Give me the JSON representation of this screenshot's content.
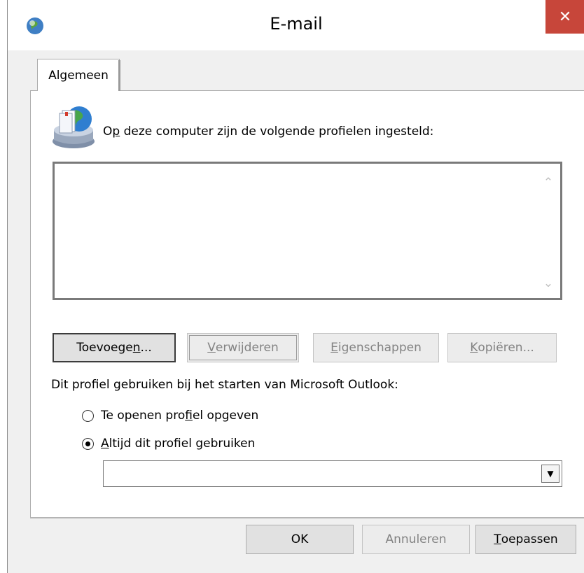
{
  "window": {
    "title": "E-mail",
    "close_glyph": "✕",
    "title_icon": "mail-globe-icon"
  },
  "tabs": [
    {
      "label": "Algemeen",
      "active": true
    }
  ],
  "profiles": {
    "icon": "mail-profiles-icon",
    "label_prefix": "O",
    "label_underlined": "p",
    "label_rest": " deze computer zijn de volgende profielen ingesteld:",
    "items": [],
    "scroll_up_glyph": "⌃",
    "scroll_down_glyph": "⌄"
  },
  "buttons": {
    "add": {
      "pre": "Toevoege",
      "u": "n",
      "post": "...",
      "enabled": true
    },
    "remove": {
      "pre": "",
      "u": "V",
      "post": "erwijderen",
      "enabled": false
    },
    "properties": {
      "pre": "",
      "u": "E",
      "post": "igenschappen",
      "enabled": false
    },
    "copy": {
      "pre": "",
      "u": "K",
      "post": "opiëren...",
      "enabled": false
    }
  },
  "startup": {
    "label": "Dit profiel gebruiken bij het starten van Microsoft Outlook:",
    "options": [
      {
        "pre": "Te openen pro",
        "u": "f",
        "post": "iel opgeven",
        "selected": false
      },
      {
        "pre": "",
        "u": "A",
        "post": "ltijd dit profiel gebruiken",
        "selected": true
      }
    ],
    "selected_profile": "",
    "dropdown_glyph": "▼"
  },
  "footer": {
    "ok": {
      "label": "OK",
      "enabled": true
    },
    "cancel": {
      "label": "Annuleren",
      "enabled": false
    },
    "apply": {
      "u": "T",
      "post": "oepassen",
      "enabled": true
    }
  },
  "colors": {
    "close_button": "#c7463a",
    "dialog_background": "#f0f0f0",
    "disabled_text": "#838383"
  }
}
